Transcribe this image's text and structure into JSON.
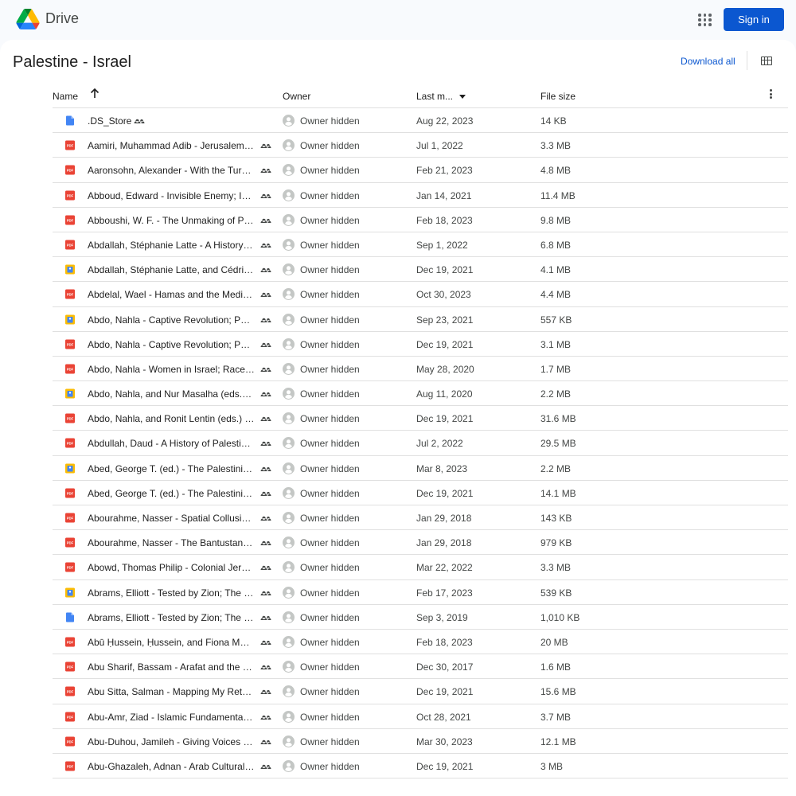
{
  "app": {
    "brand": "Drive",
    "signin_label": "Sign in"
  },
  "folder": {
    "title": "Palestine - Israel",
    "download_all_label": "Download all"
  },
  "columns": {
    "name": "Name",
    "owner": "Owner",
    "modified": "Last m...",
    "size": "File size"
  },
  "colors": {
    "accent": "#0b57d0",
    "pdf": "#ea4335",
    "doc": "#4285f4"
  },
  "files": [
    {
      "name": ".DS_Store",
      "type": "doc",
      "owner": "Owner hidden",
      "modified": "Aug 22, 2023",
      "size": "14 KB"
    },
    {
      "name": "Aamiri, Muhammad Adib - Jerusalem; ...",
      "type": "pdf",
      "owner": "Owner hidden",
      "modified": "Jul 1, 2022",
      "size": "3.3 MB"
    },
    {
      "name": "Aaronsohn, Alexander - With the Turks...",
      "type": "pdf",
      "owner": "Owner hidden",
      "modified": "Feb 21, 2023",
      "size": "4.8 MB"
    },
    {
      "name": "Abboud, Edward - Invisible Enemy; Isra...",
      "type": "pdf",
      "owner": "Owner hidden",
      "modified": "Jan 14, 2021",
      "size": "11.4 MB"
    },
    {
      "name": "Abboushi, W. F. - The Unmaking of Pal...",
      "type": "pdf",
      "owner": "Owner hidden",
      "modified": "Feb 18, 2023",
      "size": "9.8 MB"
    },
    {
      "name": "Abdallah, Stéphanie Latte - A History o...",
      "type": "pdf",
      "owner": "Owner hidden",
      "modified": "Sep 1, 2022",
      "size": "6.8 MB"
    },
    {
      "name": "Abdallah, Stéphanie Latte, and Cédric ...",
      "type": "epub",
      "owner": "Owner hidden",
      "modified": "Dec 19, 2021",
      "size": "4.1 MB"
    },
    {
      "name": "Abdelal, Wael - Hamas and the Media; ...",
      "type": "pdf",
      "owner": "Owner hidden",
      "modified": "Oct 30, 2023",
      "size": "4.4 MB"
    },
    {
      "name": "Abdo, Nahla - Captive Revolution; Pale...",
      "type": "epub",
      "owner": "Owner hidden",
      "modified": "Sep 23, 2021",
      "size": "557 KB"
    },
    {
      "name": "Abdo, Nahla - Captive Revolution; Pale...",
      "type": "pdf",
      "owner": "Owner hidden",
      "modified": "Dec 19, 2021",
      "size": "3.1 MB"
    },
    {
      "name": "Abdo, Nahla - Women in Israel; Race, ...",
      "type": "pdf",
      "owner": "Owner hidden",
      "modified": "May 28, 2020",
      "size": "1.7 MB"
    },
    {
      "name": "Abdo, Nahla, and Nur Masalha (eds.) - ...",
      "type": "epub",
      "owner": "Owner hidden",
      "modified": "Aug 11, 2020",
      "size": "2.2 MB"
    },
    {
      "name": "Abdo, Nahla, and Ronit Lentin (eds.) - ...",
      "type": "pdf",
      "owner": "Owner hidden",
      "modified": "Dec 19, 2021",
      "size": "31.6 MB"
    },
    {
      "name": "Abdullah, Daud - A History of Palestini...",
      "type": "pdf",
      "owner": "Owner hidden",
      "modified": "Jul 2, 2022",
      "size": "29.5 MB"
    },
    {
      "name": "Abed, George T. (ed.) - The Palestinian...",
      "type": "epub",
      "owner": "Owner hidden",
      "modified": "Mar 8, 2023",
      "size": "2.2 MB"
    },
    {
      "name": "Abed, George T. (ed.) - The Palestinian...",
      "type": "pdf",
      "owner": "Owner hidden",
      "modified": "Dec 19, 2021",
      "size": "14.1 MB"
    },
    {
      "name": "Abourahme, Nasser - Spatial Collusion...",
      "type": "pdf",
      "owner": "Owner hidden",
      "modified": "Jan 29, 2018",
      "size": "143 KB"
    },
    {
      "name": "Abourahme, Nasser - The Bantustan S...",
      "type": "pdf",
      "owner": "Owner hidden",
      "modified": "Jan 29, 2018",
      "size": "979 KB"
    },
    {
      "name": "Abowd, Thomas Philip - Colonial Jerus...",
      "type": "pdf",
      "owner": "Owner hidden",
      "modified": "Mar 22, 2022",
      "size": "3.3 MB"
    },
    {
      "name": "Abrams, Elliott - Tested by Zion; The B...",
      "type": "epub",
      "owner": "Owner hidden",
      "modified": "Feb 17, 2023",
      "size": "539 KB"
    },
    {
      "name": "Abrams, Elliott - Tested by Zion; The B...",
      "type": "doc",
      "owner": "Owner hidden",
      "modified": "Sep 3, 2019",
      "size": "1,010 KB"
    },
    {
      "name": "Abū Ḥussein, Ḥussein, and Fiona Mack...",
      "type": "pdf",
      "owner": "Owner hidden",
      "modified": "Feb 18, 2023",
      "size": "20 MB"
    },
    {
      "name": "Abu Sharif, Bassam - Arafat and the Dr...",
      "type": "pdf",
      "owner": "Owner hidden",
      "modified": "Dec 30, 2017",
      "size": "1.6 MB"
    },
    {
      "name": "Abu Sitta, Salman - Mapping My Retur...",
      "type": "pdf",
      "owner": "Owner hidden",
      "modified": "Dec 19, 2021",
      "size": "15.6 MB"
    },
    {
      "name": "Abu-Amr, Ziad - Islamic Fundamentalis...",
      "type": "pdf",
      "owner": "Owner hidden",
      "modified": "Oct 28, 2021",
      "size": "3.7 MB"
    },
    {
      "name": "Abu-Duhou, Jamileh - Giving Voices to...",
      "type": "pdf",
      "owner": "Owner hidden",
      "modified": "Mar 30, 2023",
      "size": "12.1 MB"
    },
    {
      "name": "Abu-Ghazaleh, Adnan - Arab Cultural ...",
      "type": "pdf",
      "owner": "Owner hidden",
      "modified": "Dec 19, 2021",
      "size": "3 MB"
    }
  ]
}
